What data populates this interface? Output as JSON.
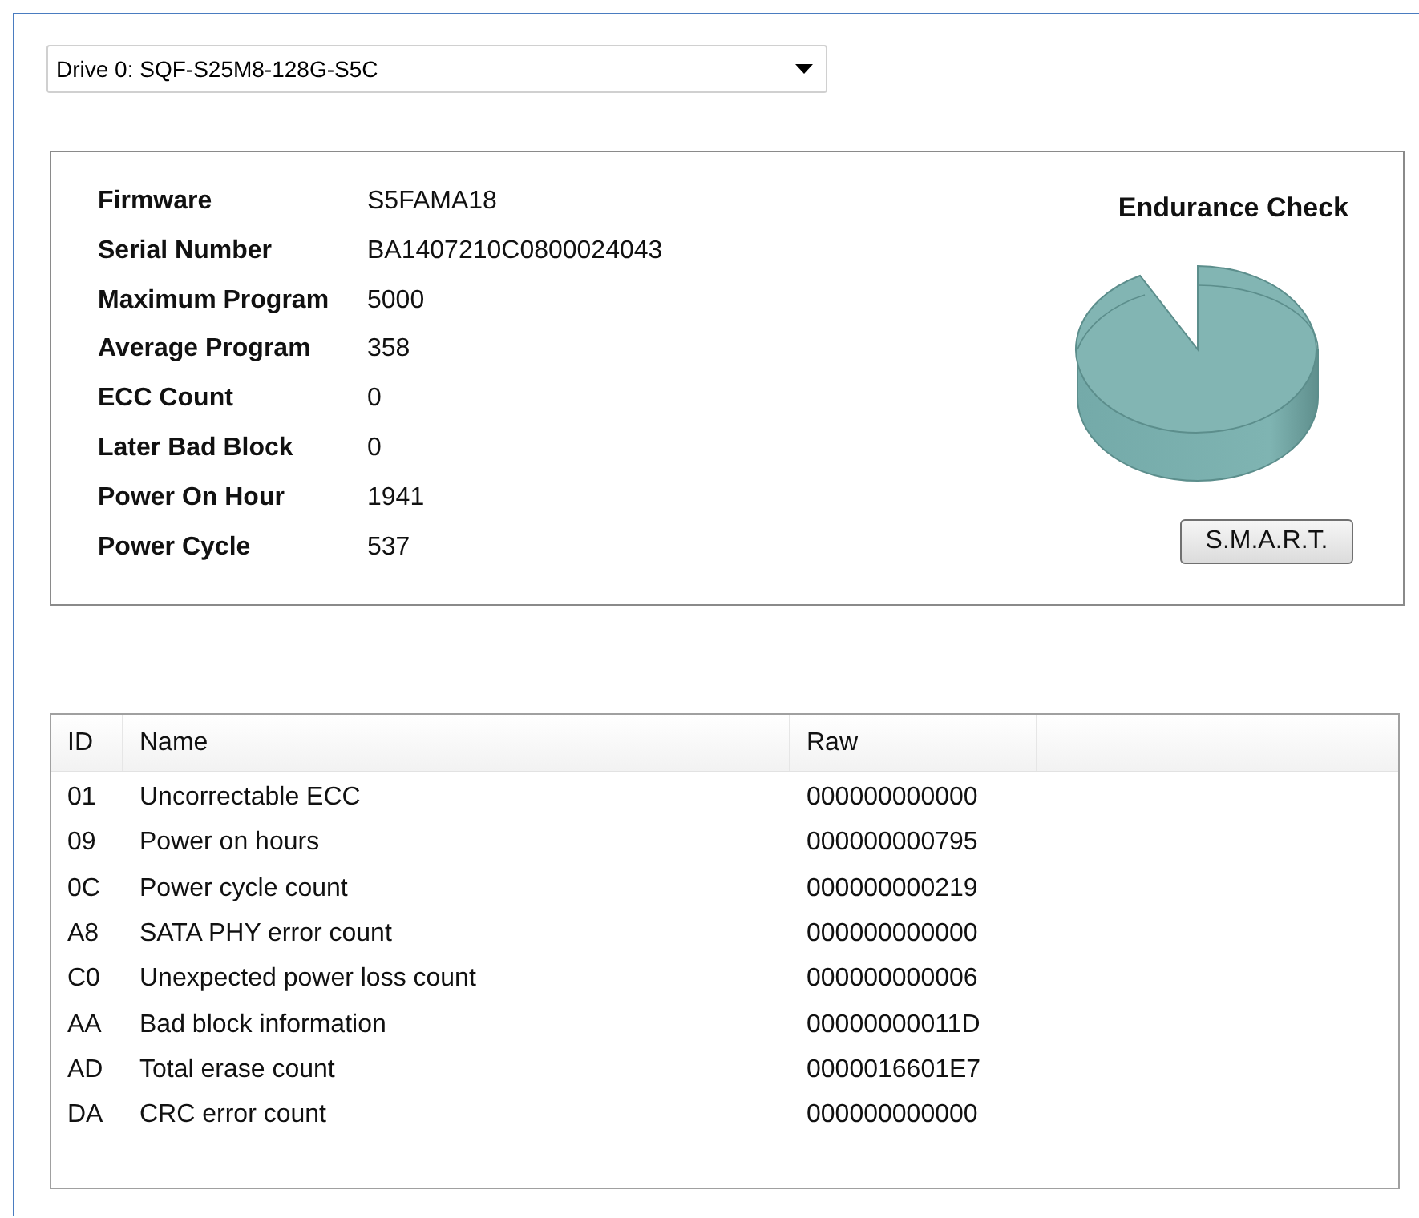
{
  "drive_select": {
    "value": "Drive 0: SQF-S25M8-128G-S5C"
  },
  "info": [
    {
      "label": "Firmware",
      "value": "S5FAMA18"
    },
    {
      "label": "Serial Number",
      "value": "BA1407210C0800024043"
    },
    {
      "label": "Maximum Program",
      "value": "5000"
    },
    {
      "label": "Average Program",
      "value": "358"
    },
    {
      "label": "ECC Count",
      "value": "0"
    },
    {
      "label": "Later Bad Block",
      "value": "0"
    },
    {
      "label": "Power On Hour",
      "value": "1941"
    },
    {
      "label": "Power Cycle",
      "value": "537"
    }
  ],
  "endurance": {
    "title": "Endurance Check",
    "button": "S.M.A.R.T."
  },
  "table": {
    "columns": [
      "ID",
      "Name",
      "Raw"
    ],
    "rows": [
      [
        "01",
        "Uncorrectable ECC",
        "000000000000"
      ],
      [
        "09",
        "Power on hours",
        "000000000795"
      ],
      [
        "0C",
        "Power cycle count",
        "000000000219"
      ],
      [
        "A8",
        "SATA PHY error count",
        "000000000000"
      ],
      [
        "C0",
        "Unexpected power loss count",
        "000000000006"
      ],
      [
        "AA",
        "Bad block information",
        "00000000011D"
      ],
      [
        "AD",
        "Total erase count",
        "0000016601E7"
      ],
      [
        "DA",
        "CRC error count",
        "000000000000"
      ]
    ]
  }
}
